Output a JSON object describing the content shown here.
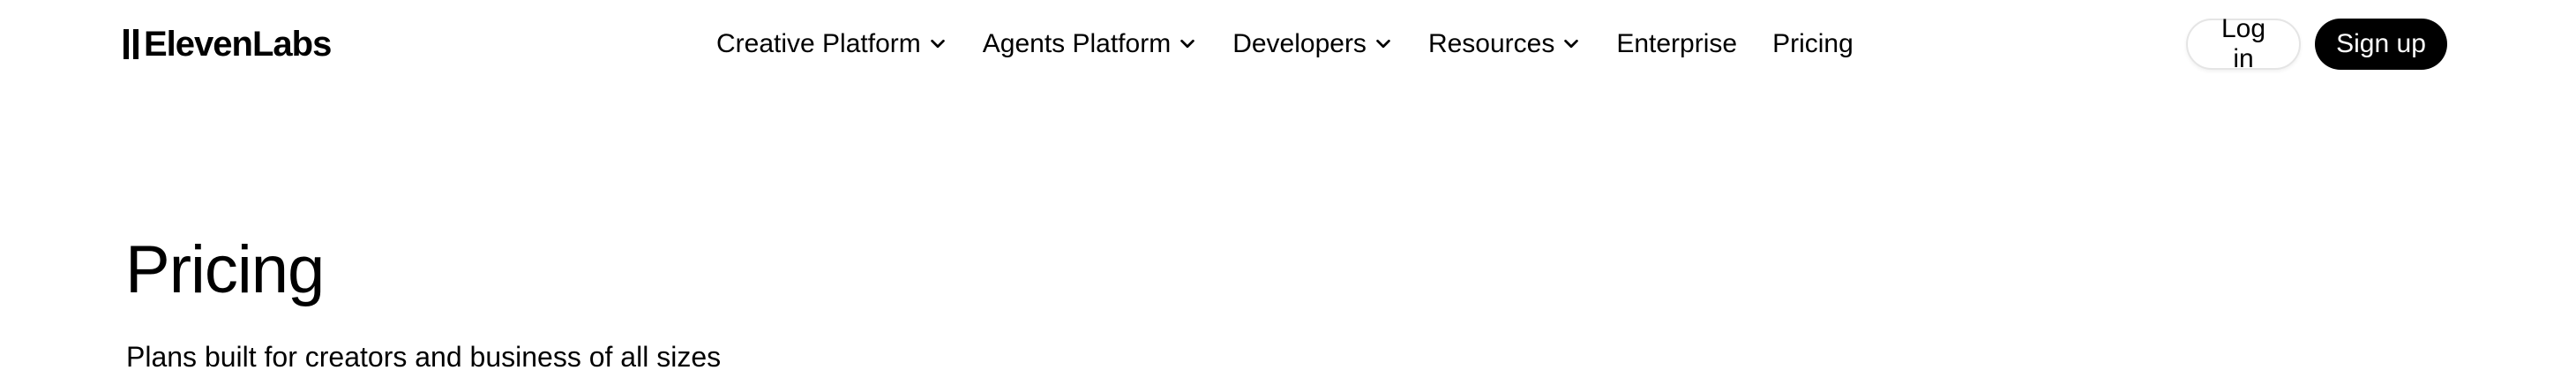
{
  "header": {
    "logo_text": "ElevenLabs",
    "nav": [
      {
        "label": "Creative Platform",
        "has_dropdown": true
      },
      {
        "label": "Agents Platform",
        "has_dropdown": true
      },
      {
        "label": "Developers",
        "has_dropdown": true
      },
      {
        "label": "Resources",
        "has_dropdown": true
      },
      {
        "label": "Enterprise",
        "has_dropdown": false
      },
      {
        "label": "Pricing",
        "has_dropdown": false
      }
    ],
    "login_label": "Log in",
    "signup_label": "Sign up"
  },
  "hero": {
    "title": "Pricing",
    "subtitle": "Plans built for creators and business of all sizes"
  },
  "colors": {
    "text": "#000000",
    "background": "#ffffff",
    "signup_bg": "#000000",
    "signup_text": "#ffffff",
    "login_border": "#e5e5e5"
  }
}
